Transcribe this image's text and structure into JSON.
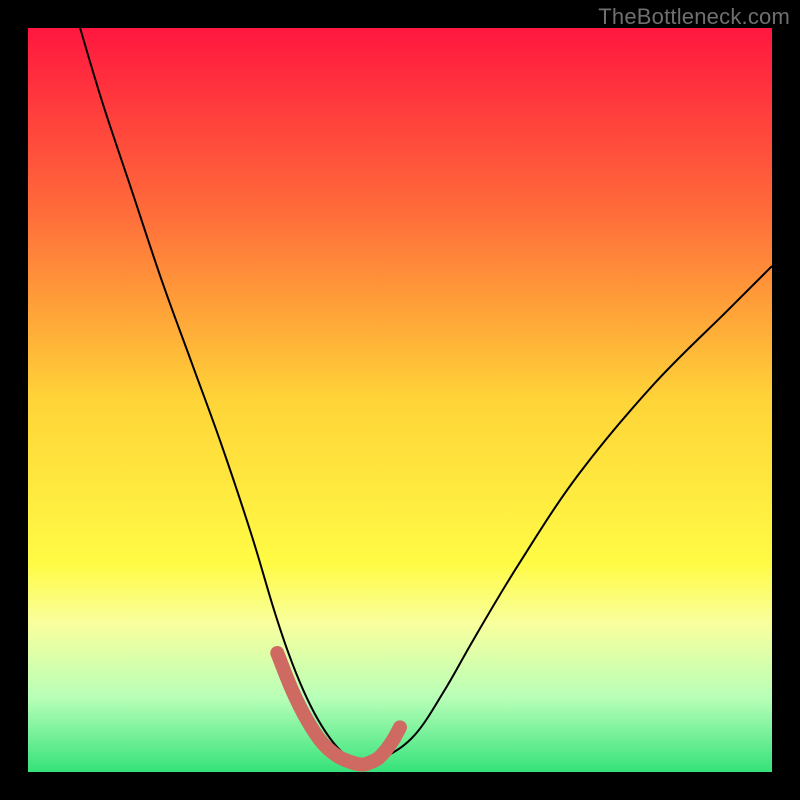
{
  "watermark": "TheBottleneck.com",
  "chart_data": {
    "type": "line",
    "title": "",
    "xlabel": "",
    "ylabel": "",
    "xlim": [
      0,
      100
    ],
    "ylim": [
      0,
      100
    ],
    "grid": false,
    "legend": false,
    "background_gradient": {
      "orientation": "vertical",
      "stops": [
        {
          "pos": 0.0,
          "color": "#ff173f"
        },
        {
          "pos": 0.25,
          "color": "#ff6d3a"
        },
        {
          "pos": 0.5,
          "color": "#ffd438"
        },
        {
          "pos": 0.72,
          "color": "#fffb45"
        },
        {
          "pos": 0.8,
          "color": "#f9ff9d"
        },
        {
          "pos": 0.9,
          "color": "#b8ffb8"
        },
        {
          "pos": 1.0,
          "color": "#35e27a"
        }
      ]
    },
    "series": [
      {
        "name": "curve-main",
        "stroke": "#000000",
        "stroke_width": 2,
        "x": [
          7,
          10,
          14,
          18,
          22,
          26,
          30,
          33,
          35,
          37,
          39,
          41,
          43,
          45,
          48,
          52,
          56,
          60,
          66,
          74,
          84,
          94,
          100
        ],
        "y": [
          100,
          90,
          78,
          66,
          55,
          44,
          32,
          22,
          16,
          11,
          7,
          4,
          2,
          1,
          2,
          5,
          11,
          18,
          28,
          40,
          52,
          62,
          68
        ]
      },
      {
        "name": "curve-highlight",
        "stroke": "#cf6a62",
        "stroke_width": 14,
        "linecap": "round",
        "x": [
          33.5,
          35.5,
          37.5,
          39.5,
          41.5,
          43.5,
          45.0,
          46.0,
          47.0,
          48.0,
          49.0,
          50.0
        ],
        "y": [
          16.0,
          11.0,
          7.0,
          4.0,
          2.2,
          1.3,
          1.0,
          1.3,
          1.8,
          2.8,
          4.2,
          6.0
        ]
      }
    ],
    "annotations": []
  }
}
